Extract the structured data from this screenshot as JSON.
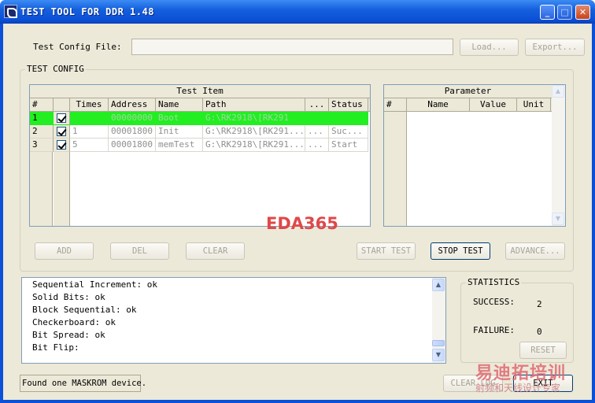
{
  "window": {
    "title": "TEST TOOL FOR DDR 1.48",
    "minimize_glyph": "_",
    "maximize_glyph": "□",
    "close_glyph": "✕"
  },
  "config_file": {
    "label": "Test Config File:",
    "value": "",
    "load_label": "Load...",
    "export_label": "Export..."
  },
  "test_config": {
    "group_label": "TEST CONFIG",
    "test_item_caption": "Test Item",
    "columns": [
      "#",
      "",
      "Times",
      "Address",
      "Name",
      "Path",
      "...",
      "Status"
    ],
    "rows": [
      {
        "num": "1",
        "checked": true,
        "times": "",
        "address": "00000000",
        "name": "Boot",
        "path": "G:\\RK2918\\[RK291",
        "extra": "",
        "status": "",
        "selected": true
      },
      {
        "num": "2",
        "checked": true,
        "times": "1",
        "address": "00001800",
        "name": "Init",
        "path": "G:\\RK2918\\[RK291...",
        "extra": "...",
        "status": "Suc...",
        "selected": false
      },
      {
        "num": "3",
        "checked": true,
        "times": "5",
        "address": "00001800",
        "name": "memTest",
        "path": "G:\\RK2918\\[RK291...",
        "extra": "...",
        "status": "Start",
        "selected": false
      }
    ],
    "parameter_caption": "Parameter",
    "parameter_columns": [
      "#",
      "Name",
      "Value",
      "Unit"
    ],
    "watermark": "EDA365"
  },
  "actions": {
    "add": "ADD",
    "del": "DEL",
    "clear": "CLEAR",
    "start_test": "START TEST",
    "stop_test": "STOP TEST",
    "advance": "ADVANCE..."
  },
  "log": {
    "lines": [
      "Sequential Increment: ok",
      "Solid Bits: ok",
      "Block Sequential: ok",
      "Checkerboard: ok",
      "Bit Spread: ok",
      "Bit Flip:"
    ]
  },
  "statistics": {
    "group_label": "STATISTICS",
    "success_label": "SUCCESS:",
    "success_value": "2",
    "failure_label": "FAILURE:",
    "failure_value": "0",
    "reset_label": "RESET"
  },
  "status_bar": {
    "message": "Found one MASKROM device.",
    "clear_log_label": "CLEAR LOG",
    "exit_label": "EXIT"
  },
  "brand": {
    "title": "易迪拓培训",
    "subtitle": "射频和天线设计专家"
  },
  "colors": {
    "titlebar": "#0a4fd6",
    "selected_row": "#22ee22",
    "dialog_bg": "#ece9d8",
    "watermark": "#e04848"
  }
}
